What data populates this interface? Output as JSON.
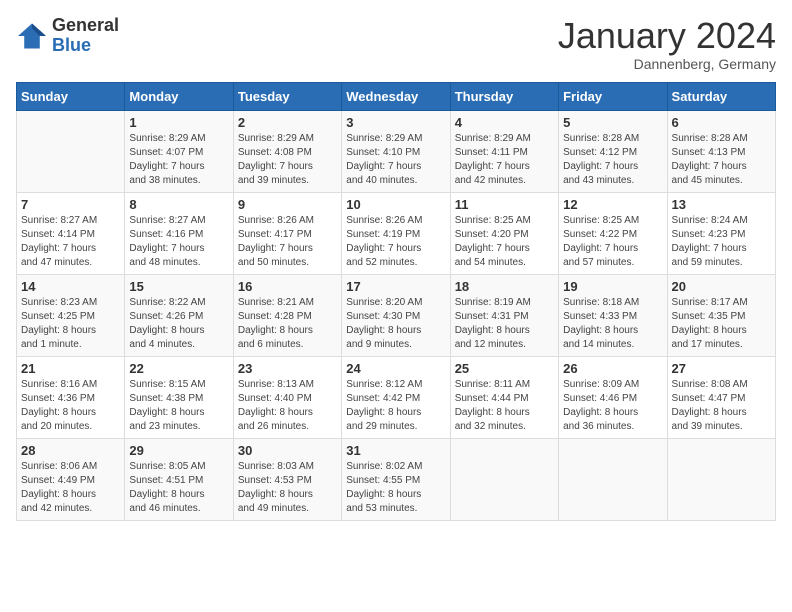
{
  "header": {
    "logo_general": "General",
    "logo_blue": "Blue",
    "title": "January 2024",
    "subtitle": "Dannenberg, Germany"
  },
  "weekdays": [
    "Sunday",
    "Monday",
    "Tuesday",
    "Wednesday",
    "Thursday",
    "Friday",
    "Saturday"
  ],
  "weeks": [
    [
      {
        "day": "",
        "detail": ""
      },
      {
        "day": "1",
        "detail": "Sunrise: 8:29 AM\nSunset: 4:07 PM\nDaylight: 7 hours\nand 38 minutes."
      },
      {
        "day": "2",
        "detail": "Sunrise: 8:29 AM\nSunset: 4:08 PM\nDaylight: 7 hours\nand 39 minutes."
      },
      {
        "day": "3",
        "detail": "Sunrise: 8:29 AM\nSunset: 4:10 PM\nDaylight: 7 hours\nand 40 minutes."
      },
      {
        "day": "4",
        "detail": "Sunrise: 8:29 AM\nSunset: 4:11 PM\nDaylight: 7 hours\nand 42 minutes."
      },
      {
        "day": "5",
        "detail": "Sunrise: 8:28 AM\nSunset: 4:12 PM\nDaylight: 7 hours\nand 43 minutes."
      },
      {
        "day": "6",
        "detail": "Sunrise: 8:28 AM\nSunset: 4:13 PM\nDaylight: 7 hours\nand 45 minutes."
      }
    ],
    [
      {
        "day": "7",
        "detail": "Sunrise: 8:27 AM\nSunset: 4:14 PM\nDaylight: 7 hours\nand 47 minutes."
      },
      {
        "day": "8",
        "detail": "Sunrise: 8:27 AM\nSunset: 4:16 PM\nDaylight: 7 hours\nand 48 minutes."
      },
      {
        "day": "9",
        "detail": "Sunrise: 8:26 AM\nSunset: 4:17 PM\nDaylight: 7 hours\nand 50 minutes."
      },
      {
        "day": "10",
        "detail": "Sunrise: 8:26 AM\nSunset: 4:19 PM\nDaylight: 7 hours\nand 52 minutes."
      },
      {
        "day": "11",
        "detail": "Sunrise: 8:25 AM\nSunset: 4:20 PM\nDaylight: 7 hours\nand 54 minutes."
      },
      {
        "day": "12",
        "detail": "Sunrise: 8:25 AM\nSunset: 4:22 PM\nDaylight: 7 hours\nand 57 minutes."
      },
      {
        "day": "13",
        "detail": "Sunrise: 8:24 AM\nSunset: 4:23 PM\nDaylight: 7 hours\nand 59 minutes."
      }
    ],
    [
      {
        "day": "14",
        "detail": "Sunrise: 8:23 AM\nSunset: 4:25 PM\nDaylight: 8 hours\nand 1 minute."
      },
      {
        "day": "15",
        "detail": "Sunrise: 8:22 AM\nSunset: 4:26 PM\nDaylight: 8 hours\nand 4 minutes."
      },
      {
        "day": "16",
        "detail": "Sunrise: 8:21 AM\nSunset: 4:28 PM\nDaylight: 8 hours\nand 6 minutes."
      },
      {
        "day": "17",
        "detail": "Sunrise: 8:20 AM\nSunset: 4:30 PM\nDaylight: 8 hours\nand 9 minutes."
      },
      {
        "day": "18",
        "detail": "Sunrise: 8:19 AM\nSunset: 4:31 PM\nDaylight: 8 hours\nand 12 minutes."
      },
      {
        "day": "19",
        "detail": "Sunrise: 8:18 AM\nSunset: 4:33 PM\nDaylight: 8 hours\nand 14 minutes."
      },
      {
        "day": "20",
        "detail": "Sunrise: 8:17 AM\nSunset: 4:35 PM\nDaylight: 8 hours\nand 17 minutes."
      }
    ],
    [
      {
        "day": "21",
        "detail": "Sunrise: 8:16 AM\nSunset: 4:36 PM\nDaylight: 8 hours\nand 20 minutes."
      },
      {
        "day": "22",
        "detail": "Sunrise: 8:15 AM\nSunset: 4:38 PM\nDaylight: 8 hours\nand 23 minutes."
      },
      {
        "day": "23",
        "detail": "Sunrise: 8:13 AM\nSunset: 4:40 PM\nDaylight: 8 hours\nand 26 minutes."
      },
      {
        "day": "24",
        "detail": "Sunrise: 8:12 AM\nSunset: 4:42 PM\nDaylight: 8 hours\nand 29 minutes."
      },
      {
        "day": "25",
        "detail": "Sunrise: 8:11 AM\nSunset: 4:44 PM\nDaylight: 8 hours\nand 32 minutes."
      },
      {
        "day": "26",
        "detail": "Sunrise: 8:09 AM\nSunset: 4:46 PM\nDaylight: 8 hours\nand 36 minutes."
      },
      {
        "day": "27",
        "detail": "Sunrise: 8:08 AM\nSunset: 4:47 PM\nDaylight: 8 hours\nand 39 minutes."
      }
    ],
    [
      {
        "day": "28",
        "detail": "Sunrise: 8:06 AM\nSunset: 4:49 PM\nDaylight: 8 hours\nand 42 minutes."
      },
      {
        "day": "29",
        "detail": "Sunrise: 8:05 AM\nSunset: 4:51 PM\nDaylight: 8 hours\nand 46 minutes."
      },
      {
        "day": "30",
        "detail": "Sunrise: 8:03 AM\nSunset: 4:53 PM\nDaylight: 8 hours\nand 49 minutes."
      },
      {
        "day": "31",
        "detail": "Sunrise: 8:02 AM\nSunset: 4:55 PM\nDaylight: 8 hours\nand 53 minutes."
      },
      {
        "day": "",
        "detail": ""
      },
      {
        "day": "",
        "detail": ""
      },
      {
        "day": "",
        "detail": ""
      }
    ]
  ]
}
